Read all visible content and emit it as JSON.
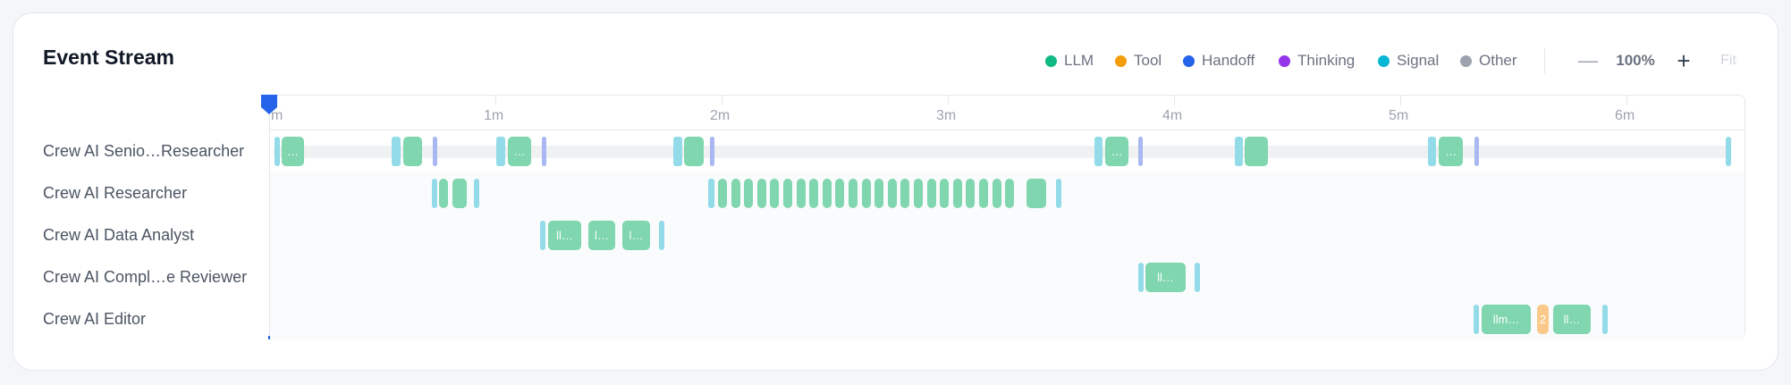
{
  "panel": {
    "title": "Event Stream"
  },
  "legend": [
    {
      "label": "LLM",
      "color": "#10b981",
      "icon": "llm-dot-icon"
    },
    {
      "label": "Tool",
      "color": "#f59e0b",
      "icon": "tool-dot-icon"
    },
    {
      "label": "Handoff",
      "color": "#2563eb",
      "icon": "handoff-dot-icon"
    },
    {
      "label": "Thinking",
      "color": "#9333ea",
      "icon": "thinking-dot-icon"
    },
    {
      "label": "Signal",
      "color": "#06b6d4",
      "icon": "signal-dot-icon"
    },
    {
      "label": "Other",
      "color": "#9ca3af",
      "icon": "other-dot-icon"
    }
  ],
  "controls": {
    "zoom_out_icon": "—",
    "zoom_level": "100%",
    "zoom_in_icon": "+",
    "fit_label": "Fit"
  },
  "axis": {
    "ticks": [
      "m",
      "1m",
      "2m",
      "3m",
      "4m",
      "5m",
      "6m"
    ]
  },
  "rows": [
    {
      "label": "Crew AI Senio…Researcher"
    },
    {
      "label": "Crew AI Researcher"
    },
    {
      "label": "Crew AI Data Analyst"
    },
    {
      "label": "Crew AI Compl…e Reviewer"
    },
    {
      "label": "Crew AI Editor"
    }
  ],
  "segment_labels": {
    "r0_llm1": "…",
    "r0_llm2": "",
    "r0_llm3": "…",
    "r0_llm4": "",
    "r0_llm5": "…",
    "r0_llm6": "",
    "r0_llm7": "…",
    "r2_llm1": "ll…",
    "r2_llm2": "l…",
    "r2_llm3": "l…",
    "r3_llm1": "ll…",
    "r4_llm1": "llm…",
    "r4_tool1": "2",
    "r4_llm2": "ll…"
  }
}
